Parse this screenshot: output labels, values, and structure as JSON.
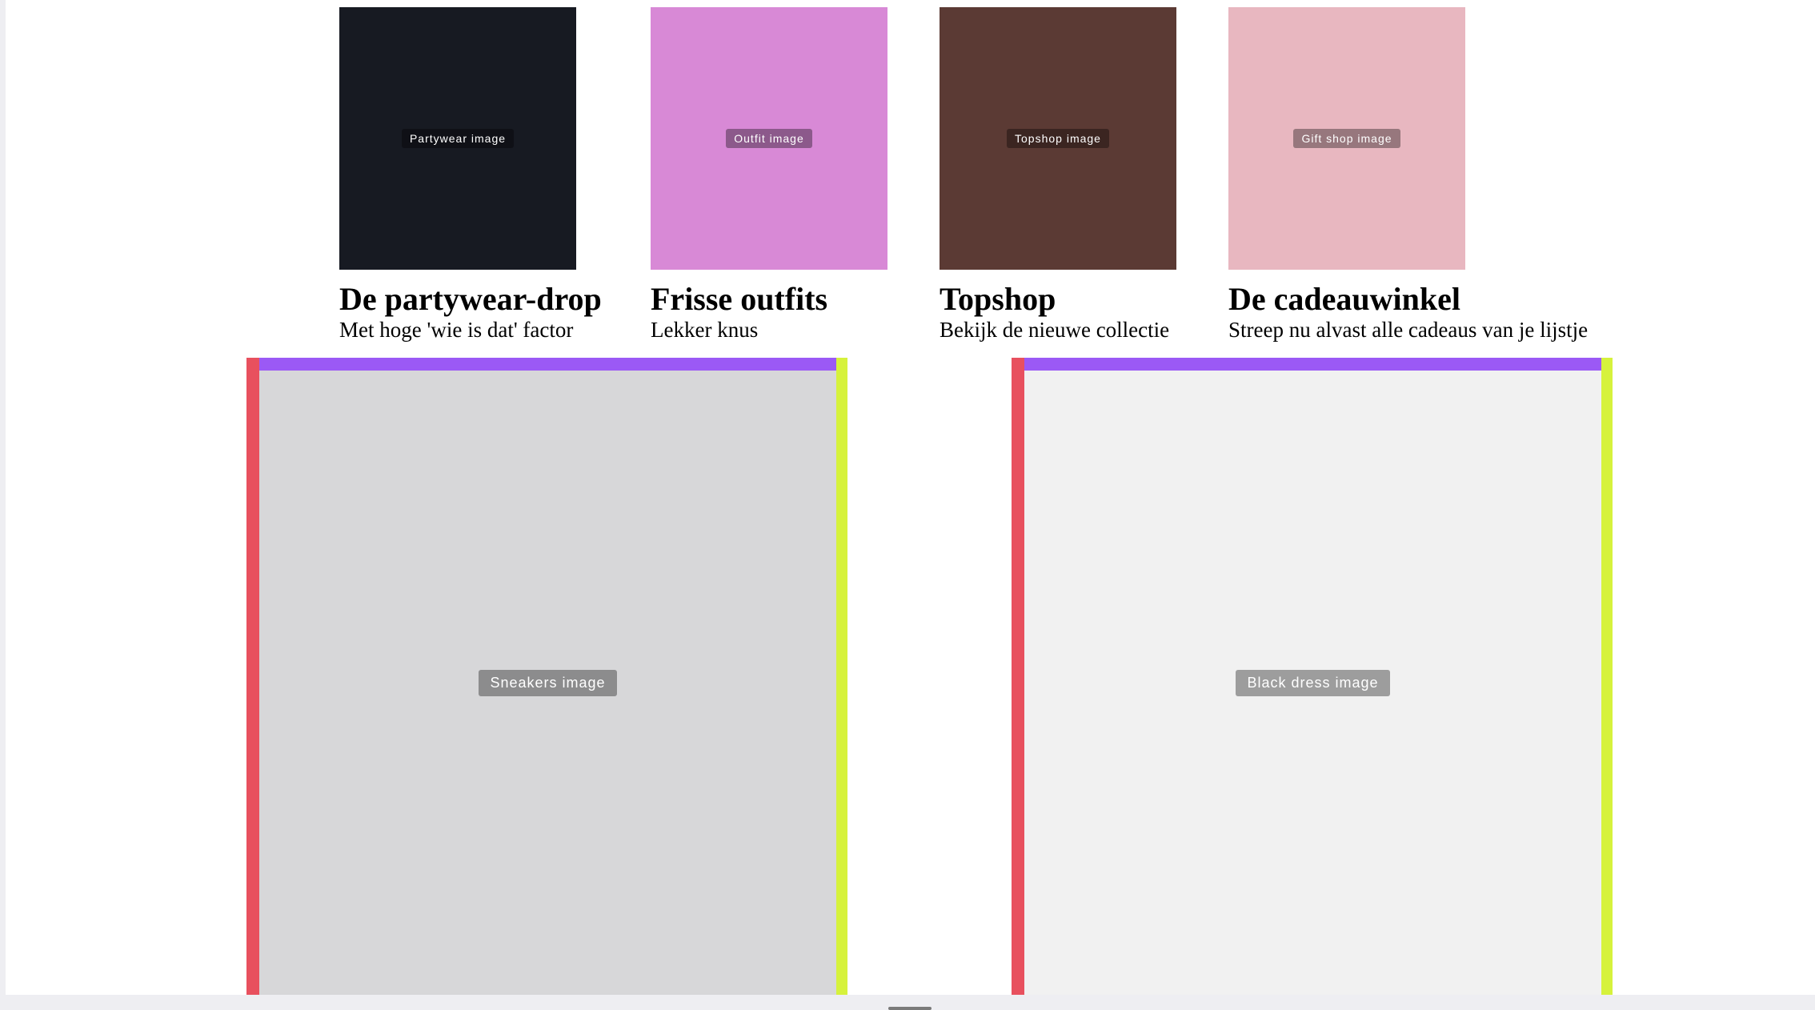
{
  "colors": {
    "accent_purple": "#9b59f5",
    "accent_red": "#e8505e",
    "accent_lime": "#d6f23c",
    "bg": "#ffffff"
  },
  "cards": [
    {
      "title": "De partywear-drop",
      "subtitle": "Met hoge 'wie is dat' factor",
      "image": "Partywear image",
      "tone": "#171a22"
    },
    {
      "title": "Frisse outfits",
      "subtitle": "Lekker knus",
      "image": "Outfit image",
      "tone": "#d889d6"
    },
    {
      "title": "Topshop",
      "subtitle": "Bekijk de nieuwe collectie",
      "image": "Topshop image",
      "tone": "#5b3a34"
    },
    {
      "title": "De cadeauwinkel",
      "subtitle": "Streep nu alvast alle cadeaus van je lijstje",
      "image": "Gift shop image",
      "tone": "#e8b7c0"
    }
  ],
  "banners": [
    {
      "image": "Sneakers image",
      "tone": "#d7d7d9"
    },
    {
      "image": "Black dress image",
      "tone": "#f1f1f1"
    }
  ]
}
